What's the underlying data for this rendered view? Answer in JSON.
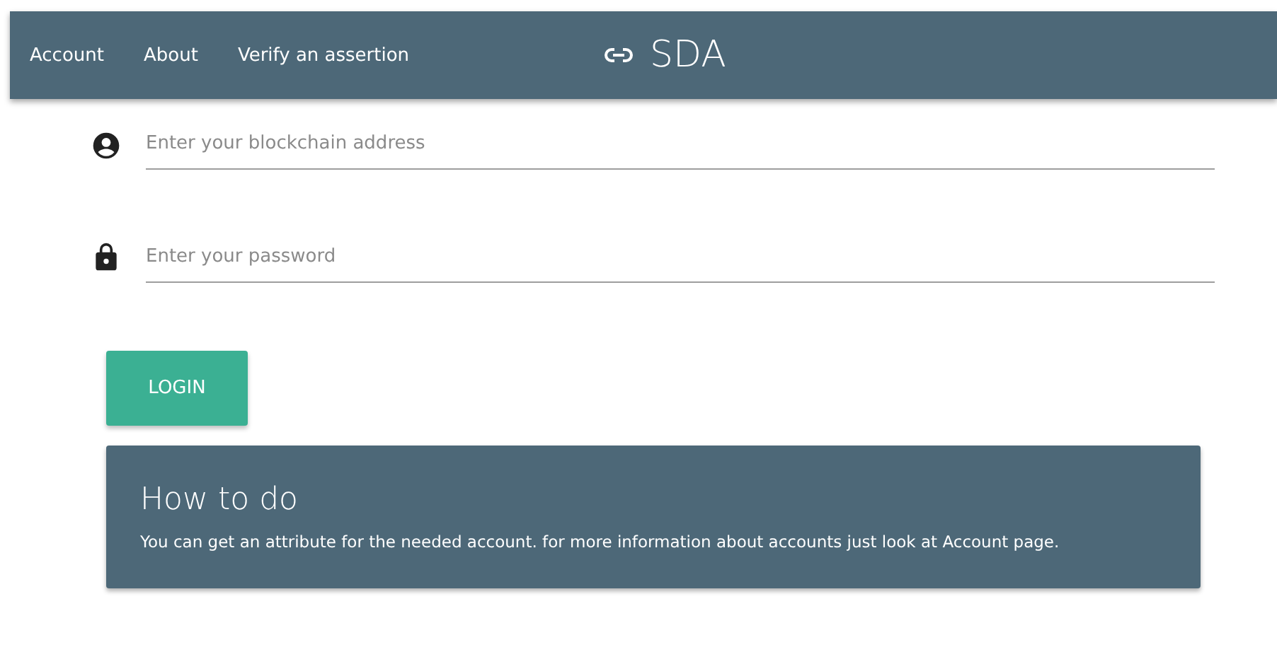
{
  "nav": {
    "links": [
      "Account",
      "About",
      "Verify an assertion"
    ],
    "brand": "SDA"
  },
  "fields": [
    {
      "kind": "address",
      "placeholder": "Enter your blockchain address"
    },
    {
      "kind": "password",
      "placeholder": "Enter your password"
    }
  ],
  "login_button": "LOGIN",
  "info_card": {
    "title": "How to do",
    "text": "You can get an attribute for the needed account. for more information about accounts just look at Account page."
  }
}
